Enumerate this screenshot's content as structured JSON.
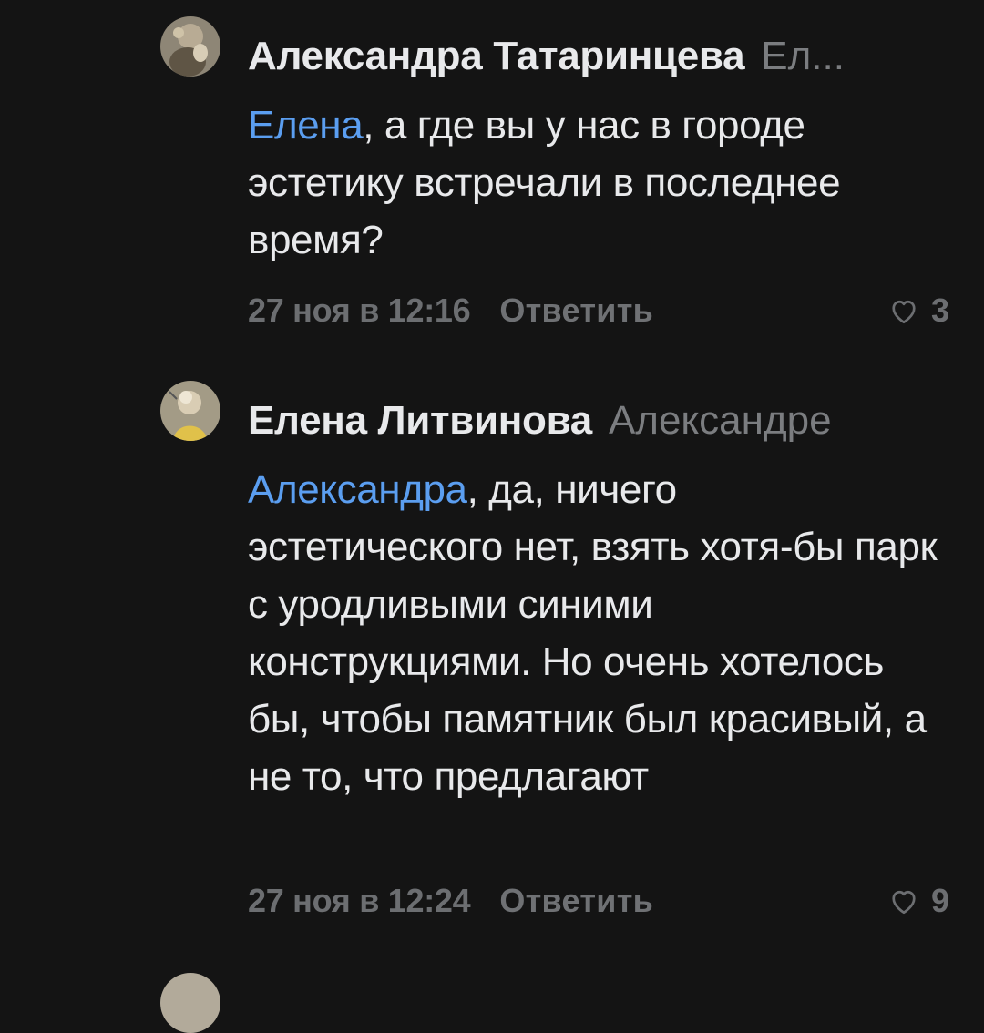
{
  "comments": [
    {
      "author": "Александра Татаринцева",
      "reply_to": "Ел...",
      "mention": "Елена",
      "text": ", а где вы  у нас в городе эстетику встречали в последнее время?",
      "date": "27 ноя в 12:16",
      "reply_label": "Ответить",
      "likes": "3",
      "avatar_icon": "user-avatar-photo"
    },
    {
      "author": "Елена Литвинова",
      "reply_to": "Александре",
      "mention": "Александра",
      "text": ", да, ничего эстетического нет, взять хотя-бы парк с уродливыми синими конструкциями. Но очень хотелось бы, чтобы памятник был красивый, а не то, что предлагают",
      "date": "27 ноя в 12:24",
      "reply_label": "Ответить",
      "likes": "9",
      "avatar_icon": "user-avatar-photo"
    }
  ],
  "colors": {
    "background": "#141414",
    "mention": "#5b9ef0",
    "secondary_text": "#6c6e71"
  }
}
